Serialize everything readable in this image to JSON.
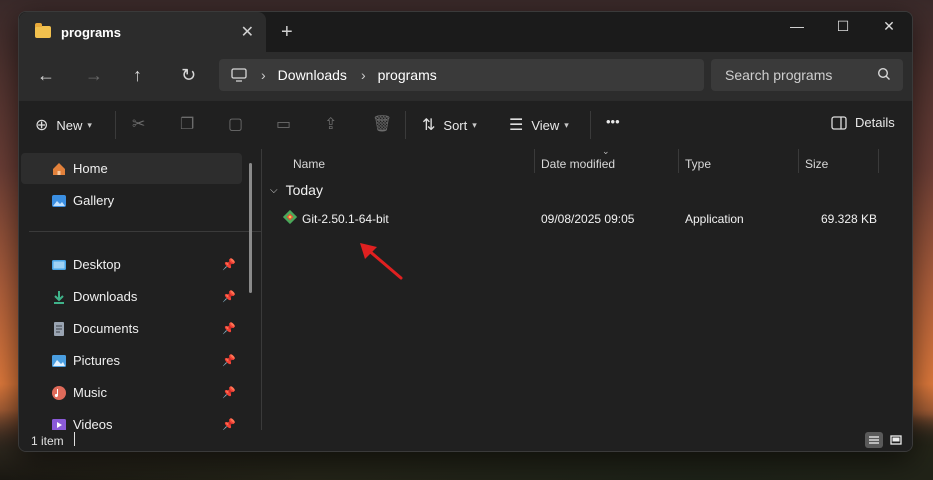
{
  "tab": {
    "title": "programs",
    "close_glyph": "✕",
    "new_tab_glyph": "+"
  },
  "window_controls": {
    "minimize": "—",
    "maximize": "☐",
    "close": "✕"
  },
  "nav": {
    "back": "←",
    "forward": "→",
    "up": "↑",
    "refresh": "↻",
    "breadcrumb": [
      "Downloads",
      "programs"
    ],
    "search_placeholder": "Search programs"
  },
  "command_bar": {
    "new_label": "New",
    "sort_label": "Sort",
    "view_label": "View",
    "more_label": "•••",
    "details_label": "Details",
    "icons": [
      "cut-icon",
      "copy-icon",
      "paste-icon",
      "rename-icon",
      "share-icon",
      "delete-icon"
    ]
  },
  "sidebar": {
    "top_items": [
      {
        "label": "Home",
        "icon": "home-icon",
        "color": "#e2813b"
      },
      {
        "label": "Gallery",
        "icon": "gallery-icon",
        "color": "#3b8fe2"
      }
    ],
    "pinned_items": [
      {
        "label": "Desktop",
        "icon": "desktop-icon",
        "color": "#4aa6e8"
      },
      {
        "label": "Downloads",
        "icon": "downloads-icon",
        "color": "#3fb38a"
      },
      {
        "label": "Documents",
        "icon": "documents-icon",
        "color": "#9aa4b2"
      },
      {
        "label": "Pictures",
        "icon": "pictures-icon",
        "color": "#4a9ee0"
      },
      {
        "label": "Music",
        "icon": "music-icon",
        "color": "#e06b5a"
      },
      {
        "label": "Videos",
        "icon": "videos-icon",
        "color": "#8a5ad8"
      }
    ]
  },
  "file_list": {
    "columns": [
      "Name",
      "Date modified",
      "Type",
      "Size"
    ],
    "group_label": "Today",
    "files": [
      {
        "name": "Git-2.50.1-64-bit",
        "date": "09/08/2025 09:05",
        "type": "Application",
        "size": "69.328 KB"
      }
    ]
  },
  "status_bar": {
    "item_count": "1 item"
  },
  "accent": {
    "annotation_arrow": "#e02020"
  }
}
